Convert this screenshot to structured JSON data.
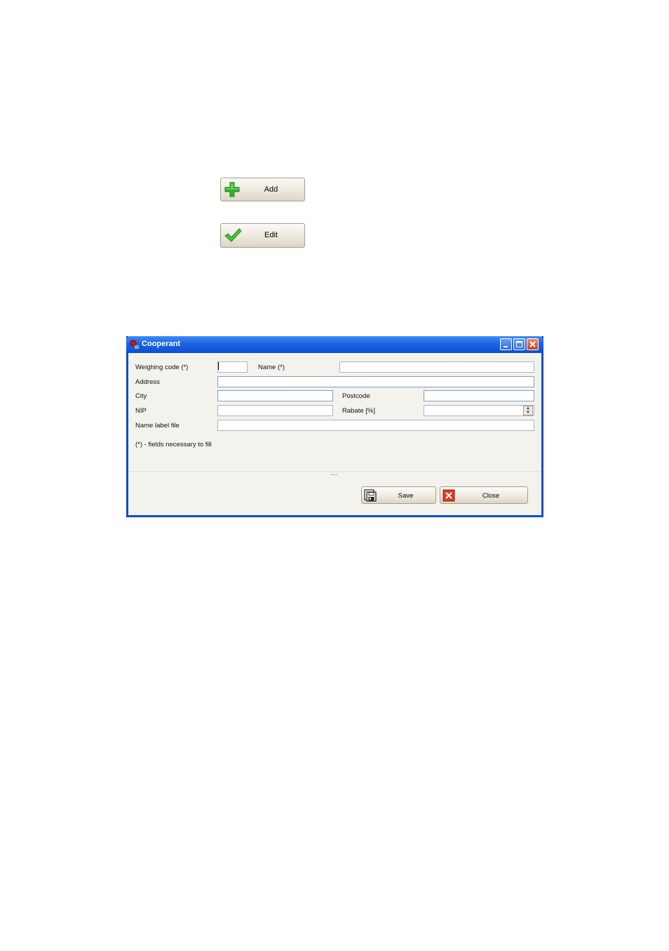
{
  "toolbar": {
    "add_label": "Add",
    "edit_label": "Edit"
  },
  "dialog": {
    "title": "Cooperant",
    "fields": {
      "weighing_code_label": "Weighing code (*)",
      "weighing_code_value": "",
      "name_label": "Name (*)",
      "name_value": "",
      "address_label": "Address",
      "address_value": "",
      "city_label": "City",
      "city_value": "",
      "postcode_label": "Postcode",
      "postcode_value": "",
      "nip_label": "NIP",
      "nip_value": "",
      "rabate_label": "Rabate [%]",
      "rabate_value": "",
      "name_label_file_label": "Name label file",
      "name_label_file_value": ""
    },
    "note": "(*) - fields necessary to fill",
    "save_label": "Save",
    "close_label": "Close"
  },
  "icons": {
    "add": "plus-icon",
    "edit": "checkmark-icon",
    "save": "floppy-disk-icon",
    "close": "red-x-icon",
    "window": "cooperant-app-icon"
  },
  "colors": {
    "titlebar": "#1f62e3",
    "window_border": "#0a4ccf",
    "add_icon": "#2fa82f",
    "edit_icon": "#3cb33c",
    "close_icon": "#d8321c"
  }
}
